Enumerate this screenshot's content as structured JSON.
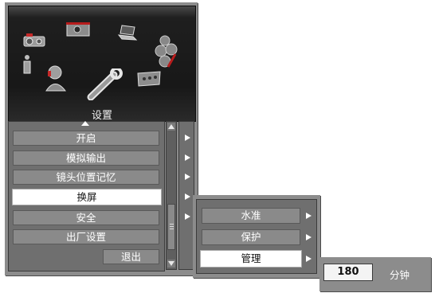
{
  "main_menu": {
    "title": "设置",
    "items": [
      {
        "label": "开启",
        "selected": false
      },
      {
        "label": "模拟输出",
        "selected": false
      },
      {
        "label": "镜头位置记忆",
        "selected": false
      },
      {
        "label": "换屏",
        "selected": true
      },
      {
        "label": "安全",
        "selected": false
      },
      {
        "label": "出厂设置",
        "selected": false
      }
    ],
    "exit_label": "退出"
  },
  "submenu": {
    "items": [
      {
        "label": "水准",
        "selected": false
      },
      {
        "label": "保护",
        "selected": false
      },
      {
        "label": "管理",
        "selected": true
      }
    ]
  },
  "value_box": {
    "value": "180",
    "unit": "分钟"
  },
  "icons": [
    "projector-icon",
    "screen-icon",
    "laptop-icon",
    "balls-icon",
    "info-icon",
    "person-icon",
    "wrench-icon",
    "remote-icon",
    "arrow-right-icon",
    "scroll-up-icon",
    "scroll-down-icon"
  ]
}
